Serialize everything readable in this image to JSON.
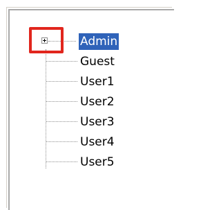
{
  "tree": {
    "root": {
      "label": "Admin",
      "expanded": false,
      "selected": true
    },
    "children": [
      {
        "label": "Guest"
      },
      {
        "label": "User1"
      },
      {
        "label": "User2"
      },
      {
        "label": "User3"
      },
      {
        "label": "User4"
      },
      {
        "label": "User5"
      }
    ]
  },
  "colors": {
    "selection": "#2f63b9",
    "highlight": "#e1261d"
  },
  "icons": {
    "expander": "plus-box-icon"
  }
}
